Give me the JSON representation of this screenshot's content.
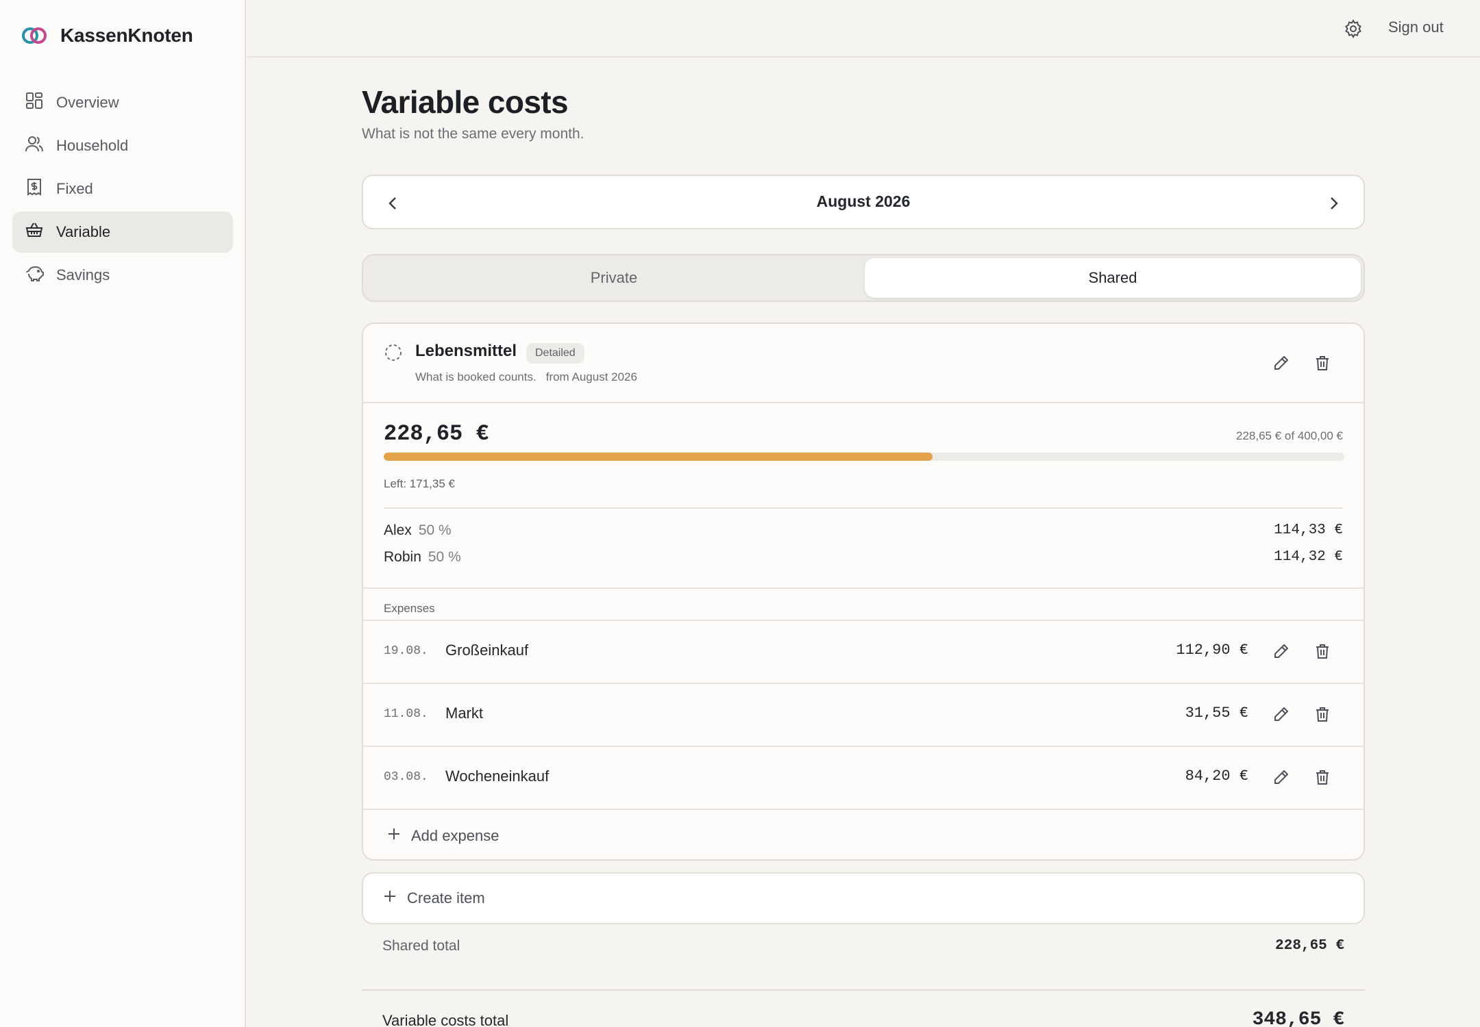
{
  "app": {
    "name": "KassenKnoten"
  },
  "sidebar": {
    "items": [
      {
        "label": "Overview",
        "icon": "grid-icon",
        "active": false
      },
      {
        "label": "Household",
        "icon": "users-icon",
        "active": false
      },
      {
        "label": "Fixed",
        "icon": "receipt-icon",
        "active": false
      },
      {
        "label": "Variable",
        "icon": "basket-icon",
        "active": true
      },
      {
        "label": "Savings",
        "icon": "piggy-bank-icon",
        "active": false
      }
    ]
  },
  "topbar": {
    "settings_icon": "gear-icon",
    "sign_out": "Sign out"
  },
  "page": {
    "title": "Variable costs",
    "subtitle": "What is not the same every month."
  },
  "month": {
    "label": "August 2026"
  },
  "toggle": {
    "private": "Private",
    "shared": "Shared",
    "selected": "Shared"
  },
  "item": {
    "name": "Lebensmittel",
    "badge": "Detailed",
    "desc": "What is booked counts.",
    "from": "from August 2026",
    "amount": "228,65 €",
    "of_text": "228,65 € of 400,00 €",
    "progress": 0.5716,
    "left": "Left: 171,35 €",
    "progress_color": "#e4a24b",
    "split": [
      {
        "name": "Alex",
        "pct": "50 %",
        "value": "114,33 €"
      },
      {
        "name": "Robin",
        "pct": "50 %",
        "value": "114,32 €"
      }
    ],
    "expenses_label": "Expenses",
    "expenses": [
      {
        "date": "19.08.",
        "desc": "Großeinkauf",
        "value": "112,90 €"
      },
      {
        "date": "11.08.",
        "desc": "Markt",
        "value": "31,55 €"
      },
      {
        "date": "03.08.",
        "desc": "Wocheneinkauf",
        "value": "84,20 €"
      }
    ],
    "add_expense": "Add expense"
  },
  "create_item": "Create item",
  "totals": {
    "shared_label": "Shared total",
    "shared_value": "228,65 €",
    "variable_label": "Variable costs total",
    "variable_value": "348,65 €"
  }
}
